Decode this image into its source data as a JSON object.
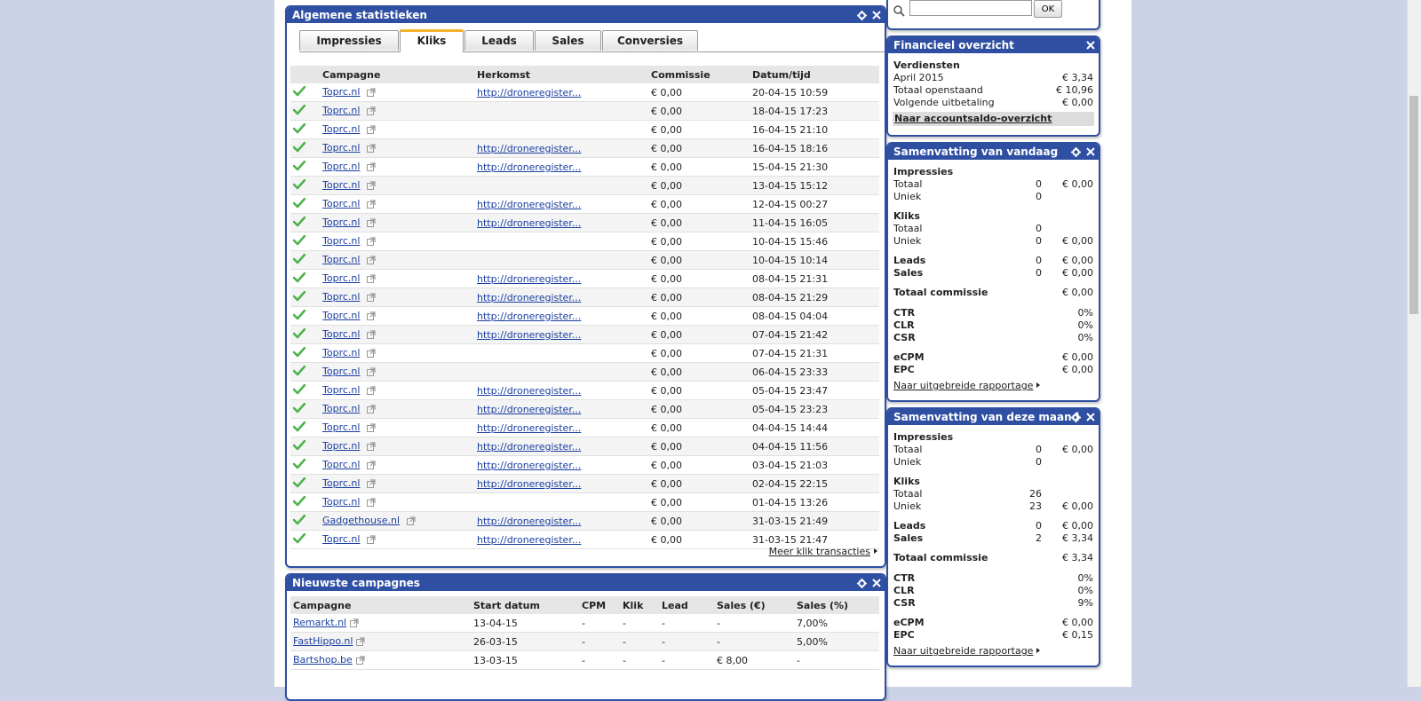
{
  "main": {
    "title": "Algemene statistieken",
    "tabs": [
      {
        "label": "Impressies"
      },
      {
        "label": "Kliks"
      },
      {
        "label": "Leads"
      },
      {
        "label": "Sales"
      },
      {
        "label": "Conversies"
      }
    ],
    "active_tab": "Kliks",
    "columns": [
      "Campagne",
      "Herkomst",
      "Commissie",
      "Datum/tijd"
    ],
    "rows": [
      {
        "campaign": "Toprc.nl",
        "source": "http://droneregister...",
        "commission": "€ 0,00",
        "datetime": "20-04-15 10:59"
      },
      {
        "campaign": "Toprc.nl",
        "source": "",
        "commission": "€ 0,00",
        "datetime": "18-04-15 17:23"
      },
      {
        "campaign": "Toprc.nl",
        "source": "",
        "commission": "€ 0,00",
        "datetime": "16-04-15 21:10"
      },
      {
        "campaign": "Toprc.nl",
        "source": "http://droneregister...",
        "commission": "€ 0,00",
        "datetime": "16-04-15 18:16"
      },
      {
        "campaign": "Toprc.nl",
        "source": "http://droneregister...",
        "commission": "€ 0,00",
        "datetime": "15-04-15 21:30"
      },
      {
        "campaign": "Toprc.nl",
        "source": "",
        "commission": "€ 0,00",
        "datetime": "13-04-15 15:12"
      },
      {
        "campaign": "Toprc.nl",
        "source": "http://droneregister...",
        "commission": "€ 0,00",
        "datetime": "12-04-15 00:27"
      },
      {
        "campaign": "Toprc.nl",
        "source": "http://droneregister...",
        "commission": "€ 0,00",
        "datetime": "11-04-15 16:05"
      },
      {
        "campaign": "Toprc.nl",
        "source": "",
        "commission": "€ 0,00",
        "datetime": "10-04-15 15:46"
      },
      {
        "campaign": "Toprc.nl",
        "source": "",
        "commission": "€ 0,00",
        "datetime": "10-04-15 10:14"
      },
      {
        "campaign": "Toprc.nl",
        "source": "http://droneregister...",
        "commission": "€ 0,00",
        "datetime": "08-04-15 21:31"
      },
      {
        "campaign": "Toprc.nl",
        "source": "http://droneregister...",
        "commission": "€ 0,00",
        "datetime": "08-04-15 21:29"
      },
      {
        "campaign": "Toprc.nl",
        "source": "http://droneregister...",
        "commission": "€ 0,00",
        "datetime": "08-04-15 04:04"
      },
      {
        "campaign": "Toprc.nl",
        "source": "http://droneregister...",
        "commission": "€ 0,00",
        "datetime": "07-04-15 21:42"
      },
      {
        "campaign": "Toprc.nl",
        "source": "",
        "commission": "€ 0,00",
        "datetime": "07-04-15 21:31"
      },
      {
        "campaign": "Toprc.nl",
        "source": "",
        "commission": "€ 0,00",
        "datetime": "06-04-15 23:33"
      },
      {
        "campaign": "Toprc.nl",
        "source": "http://droneregister...",
        "commission": "€ 0,00",
        "datetime": "05-04-15 23:47"
      },
      {
        "campaign": "Toprc.nl",
        "source": "http://droneregister...",
        "commission": "€ 0,00",
        "datetime": "05-04-15 23:23"
      },
      {
        "campaign": "Toprc.nl",
        "source": "http://droneregister...",
        "commission": "€ 0,00",
        "datetime": "04-04-15 14:44"
      },
      {
        "campaign": "Toprc.nl",
        "source": "http://droneregister...",
        "commission": "€ 0,00",
        "datetime": "04-04-15 11:56"
      },
      {
        "campaign": "Toprc.nl",
        "source": "http://droneregister...",
        "commission": "€ 0,00",
        "datetime": "03-04-15 21:03"
      },
      {
        "campaign": "Toprc.nl",
        "source": "http://droneregister...",
        "commission": "€ 0,00",
        "datetime": "02-04-15 22:15"
      },
      {
        "campaign": "Toprc.nl",
        "source": "",
        "commission": "€ 0,00",
        "datetime": "01-04-15 13:26"
      },
      {
        "campaign": "Gadgethouse.nl",
        "source": "http://droneregister...",
        "commission": "€ 0,00",
        "datetime": "31-03-15 21:49"
      },
      {
        "campaign": "Toprc.nl",
        "source": "http://droneregister...",
        "commission": "€ 0,00",
        "datetime": "31-03-15 21:47"
      }
    ],
    "more_link": "Meer klik transacties"
  },
  "campaigns": {
    "title": "Nieuwste campagnes",
    "columns": [
      "Campagne",
      "Start datum",
      "CPM",
      "Klik",
      "Lead",
      "Sales (€)",
      "Sales (%)"
    ],
    "rows": [
      {
        "name": "Remarkt.nl",
        "start": "13-04-15",
        "cpm": "-",
        "klik": "-",
        "lead": "-",
        "sales_eur": "-",
        "sales_pct": "7,00%"
      },
      {
        "name": "FastHippo.nl",
        "start": "26-03-15",
        "cpm": "-",
        "klik": "-",
        "lead": "-",
        "sales_eur": "-",
        "sales_pct": "5,00%"
      },
      {
        "name": "Bartshop.be",
        "start": "13-03-15",
        "cpm": "-",
        "klik": "-",
        "lead": "-",
        "sales_eur": "€ 8,00",
        "sales_pct": "-"
      }
    ]
  },
  "search": {
    "button": "OK",
    "value": ""
  },
  "financial": {
    "title": "Financieel overzicht",
    "heading": "Verdiensten",
    "rows": [
      {
        "label": "April 2015",
        "value": "€ 3,34"
      },
      {
        "label": "Totaal openstaand",
        "value": "€ 10,96"
      },
      {
        "label": "Volgende uitbetaling",
        "value": "€ 0,00"
      }
    ],
    "link": "Naar accountsaldo-overzicht"
  },
  "today": {
    "title": "Samenvatting van vandaag",
    "impressions_heading": "Impressies",
    "imp_total": {
      "label": "Totaal",
      "count": "0",
      "amount": "€ 0,00"
    },
    "imp_unique": {
      "label": "Uniek",
      "count": "0",
      "amount": ""
    },
    "clicks_heading": "Kliks",
    "clk_total": {
      "label": "Totaal",
      "count": "0",
      "amount": ""
    },
    "clk_unique": {
      "label": "Uniek",
      "count": "0",
      "amount": "€ 0,00"
    },
    "leads": {
      "label": "Leads",
      "count": "0",
      "amount": "€ 0,00"
    },
    "sales": {
      "label": "Sales",
      "count": "0",
      "amount": "€ 0,00"
    },
    "total_commission": {
      "label": "Totaal commissie",
      "amount": "€ 0,00"
    },
    "ctr": {
      "label": "CTR",
      "value": "0%"
    },
    "clr": {
      "label": "CLR",
      "value": "0%"
    },
    "csr": {
      "label": "CSR",
      "value": "0%"
    },
    "ecpm": {
      "label": "eCPM",
      "value": "€ 0,00"
    },
    "epc": {
      "label": "EPC",
      "value": "€ 0,00"
    },
    "link": "Naar uitgebreide rapportage"
  },
  "month": {
    "title": "Samenvatting van deze maand",
    "impressions_heading": "Impressies",
    "imp_total": {
      "label": "Totaal",
      "count": "0",
      "amount": "€ 0,00"
    },
    "imp_unique": {
      "label": "Uniek",
      "count": "0",
      "amount": ""
    },
    "clicks_heading": "Kliks",
    "clk_total": {
      "label": "Totaal",
      "count": "26",
      "amount": ""
    },
    "clk_unique": {
      "label": "Uniek",
      "count": "23",
      "amount": "€ 0,00"
    },
    "leads": {
      "label": "Leads",
      "count": "0",
      "amount": "€ 0,00"
    },
    "sales": {
      "label": "Sales",
      "count": "2",
      "amount": "€ 3,34"
    },
    "total_commission": {
      "label": "Totaal commissie",
      "amount": "€ 3,34"
    },
    "ctr": {
      "label": "CTR",
      "value": "0%"
    },
    "clr": {
      "label": "CLR",
      "value": "0%"
    },
    "csr": {
      "label": "CSR",
      "value": "9%"
    },
    "ecpm": {
      "label": "eCPM",
      "value": "€ 0,00"
    },
    "epc": {
      "label": "EPC",
      "value": "€ 0,15"
    },
    "link": "Naar uitgebreide rapportage"
  },
  "colors": {
    "header": "#2f4fa3",
    "link": "#1b3fa0",
    "check": "#4db34d",
    "active_tab": "#f3b32a"
  }
}
